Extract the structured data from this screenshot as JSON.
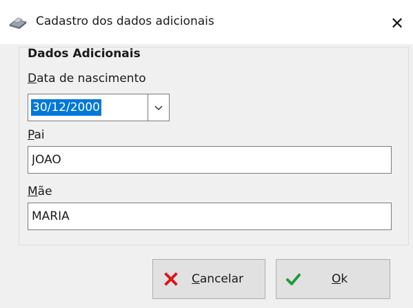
{
  "window": {
    "title": "Cadastro dos dados adicionais",
    "close_glyph": "✕",
    "icon": "app-icon"
  },
  "group": {
    "title": "Dados Adicionais"
  },
  "fields": {
    "birthdate": {
      "label_accel": "D",
      "label_rest": "ata de nascimento",
      "value": "30/12/2000"
    },
    "father": {
      "label_accel": "P",
      "label_rest": "ai",
      "value": "JOAO"
    },
    "mother": {
      "label_accel": "M",
      "label_rest": "ãe",
      "value": "MARIA"
    }
  },
  "buttons": {
    "cancel": {
      "label_accel": "C",
      "label_rest": "ancelar",
      "icon": "close-icon",
      "icon_color": "#d7191c"
    },
    "ok": {
      "label_accel": "O",
      "label_rest": "k",
      "icon": "check-icon",
      "icon_color": "#1f9a3a"
    }
  },
  "colors": {
    "selection": "#0078d7",
    "window_bg": "#f0f0f0",
    "titlebar_bg": "#ffffff"
  }
}
